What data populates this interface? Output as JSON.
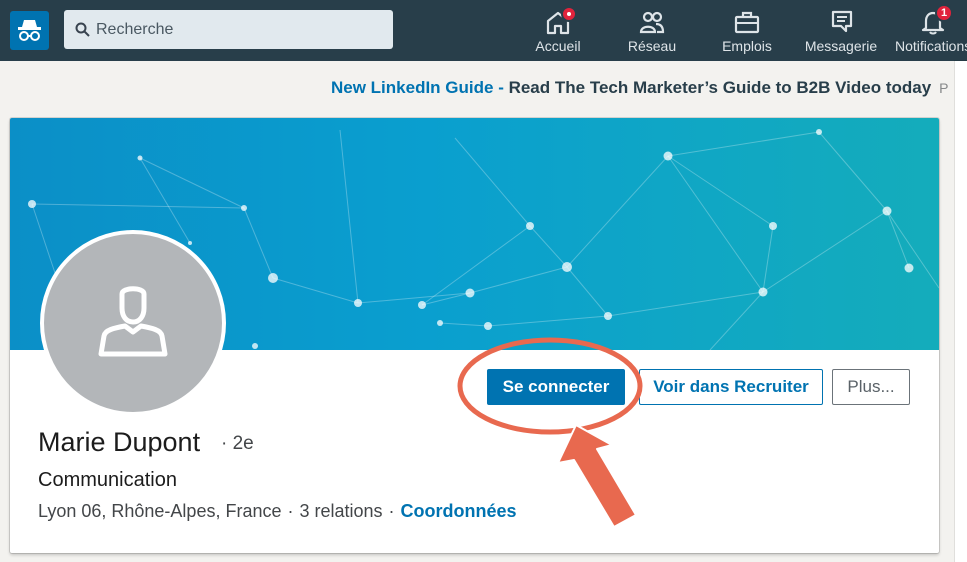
{
  "nav": {
    "search_placeholder": "Recherche",
    "items": [
      {
        "label": "Accueil",
        "icon": "home-icon"
      },
      {
        "label": "Réseau",
        "icon": "network-icon"
      },
      {
        "label": "Emplois",
        "icon": "briefcase-icon"
      },
      {
        "label": "Messagerie",
        "icon": "messaging-icon"
      },
      {
        "label": "Notifications",
        "icon": "bell-icon",
        "badge": "1"
      }
    ]
  },
  "ad": {
    "link": "New LinkedIn Guide",
    "separator": " - ",
    "text": "Read The Tech Marketer’s Guide to B2B Video today",
    "tag": "P"
  },
  "profile": {
    "name": "Marie Dupont",
    "degree": "· 2e",
    "headline": "Communication",
    "location": "Lyon 06, Rhône-Alpes, France",
    "relations": "3 relations",
    "contact": "Coordonnées",
    "sep": "·"
  },
  "actions": {
    "connect": "Se connecter",
    "recruiter": "Voir dans Recruiter",
    "more": "Plus..."
  },
  "colors": {
    "topbar": "#283e4a",
    "brand": "#0073b1",
    "annotation": "#e8694f"
  }
}
